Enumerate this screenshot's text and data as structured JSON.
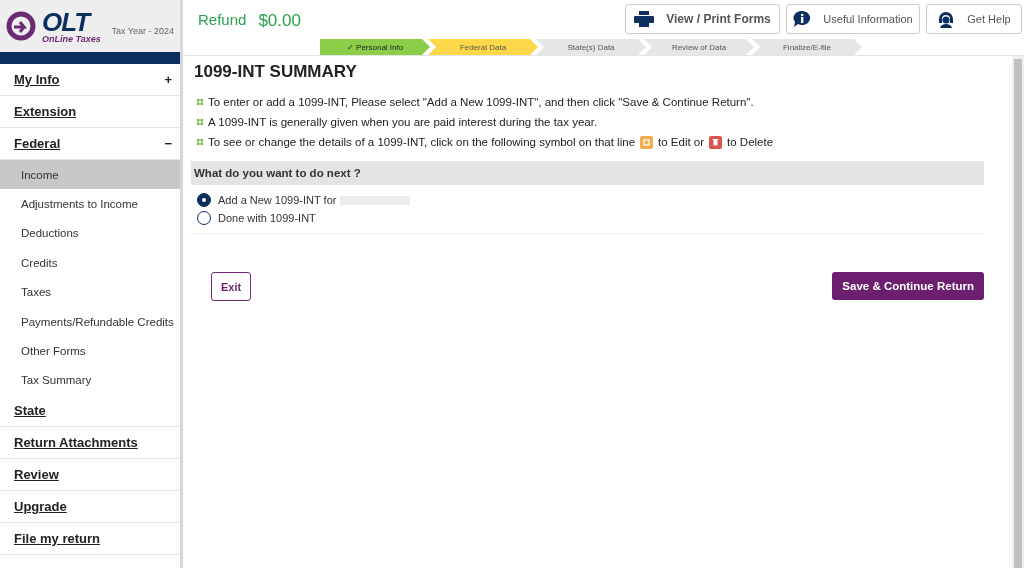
{
  "logo": {
    "name": "OLT",
    "tagline": "OnLine Taxes",
    "tax_year": "Tax Year - 2024"
  },
  "refund": {
    "label": "Refund",
    "amount": "$0.00"
  },
  "header_buttons": [
    {
      "kind": "print",
      "label": "View / Print Forms"
    },
    {
      "kind": "info",
      "label": "Useful Information"
    },
    {
      "kind": "help",
      "label": "Get Help"
    }
  ],
  "steps": [
    {
      "label": "Personal Info",
      "kind": "done",
      "check": "✓"
    },
    {
      "label": "Federal Data",
      "kind": "current"
    },
    {
      "label": "State(s) Data",
      "kind": "pending"
    },
    {
      "label": "Review of Data",
      "kind": "pending"
    },
    {
      "label": "Finalize/E-file",
      "kind": "pending"
    }
  ],
  "sidebar": [
    {
      "label": "My Info",
      "toggle": "+"
    },
    {
      "label": "Extension"
    },
    {
      "label": "Federal",
      "toggle": "−",
      "children": [
        {
          "label": "Income",
          "selected": true
        },
        {
          "label": "Adjustments to Income",
          "selected": false
        },
        {
          "label": "Deductions",
          "selected": false
        },
        {
          "label": "Credits",
          "selected": false
        },
        {
          "label": "Taxes",
          "selected": false
        },
        {
          "label": "Payments/Refundable Credits",
          "selected": false
        },
        {
          "label": "Other Forms",
          "selected": false
        },
        {
          "label": "Tax Summary",
          "selected": false
        }
      ]
    },
    {
      "label": "State"
    },
    {
      "label": "Return Attachments"
    },
    {
      "label": "Review"
    },
    {
      "label": "Upgrade"
    },
    {
      "label": "File my return"
    }
  ],
  "title": "1099-INT SUMMARY",
  "instructions": [
    {
      "text": "To enter or add a 1099-INT, Please select \"Add a New 1099-INT\", and then click \"Save & Continue Return\"."
    },
    {
      "text": "A 1099-INT is generally given when you are paid interest during the tax year."
    },
    {
      "text": "To see or change the details of a 1099-INT, click on the following symbol on that line",
      "edit_text": "to Edit or",
      "delete_text": "to Delete"
    }
  ],
  "question": "What do you want to do next ?",
  "options": [
    {
      "label": "Add a New 1099-INT for",
      "selected": true,
      "redacted": true
    },
    {
      "label": "Done with 1099-INT",
      "selected": false
    }
  ],
  "exit_button": "Exit",
  "continue_button": "Save & Continue Return"
}
